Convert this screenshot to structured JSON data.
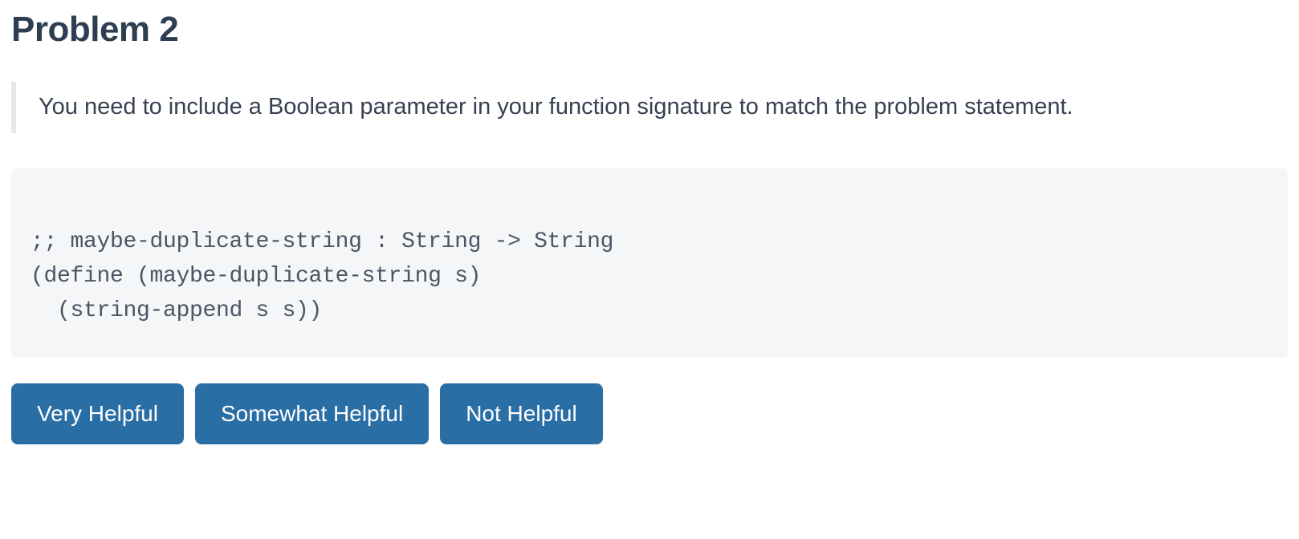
{
  "title": "Problem 2",
  "feedback": "You need to include a Boolean parameter in your function signature to match the problem statement.",
  "code": ";; maybe-duplicate-string : String -> String\n(define (maybe-duplicate-string s)\n  (string-append s s))",
  "buttons": {
    "very_helpful": "Very Helpful",
    "somewhat_helpful": "Somewhat Helpful",
    "not_helpful": "Not Helpful"
  }
}
